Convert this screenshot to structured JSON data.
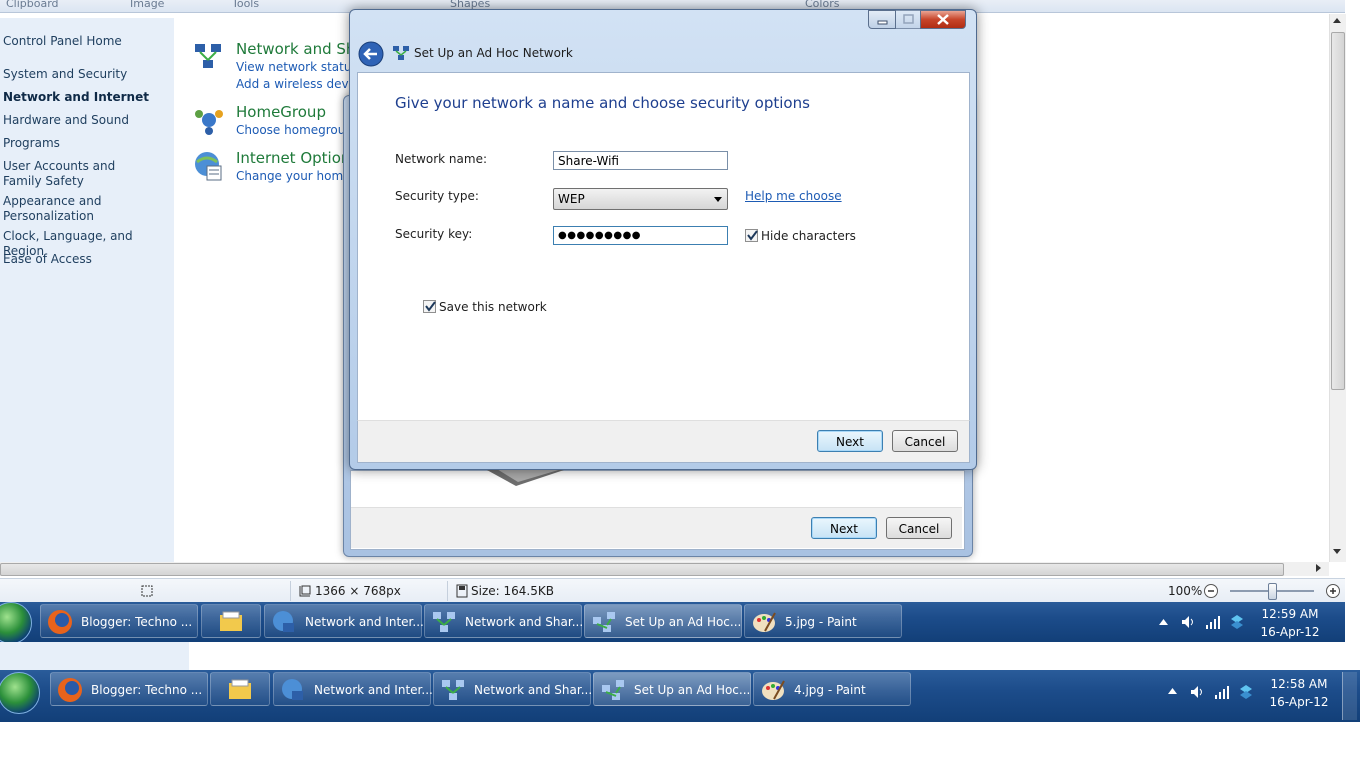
{
  "ribbon": {
    "labels": [
      "Clipboard",
      "Image",
      "Tools",
      "Shapes",
      "Colors"
    ]
  },
  "sidebar": {
    "home": "Control Panel Home",
    "items": [
      "System and Security",
      "Network and Internet",
      "Hardware and Sound",
      "Programs",
      "User Accounts and Family Safety",
      "Appearance and Personalization",
      "Clock, Language, and Region",
      "Ease of Access"
    ]
  },
  "main": {
    "categories": [
      {
        "title": "Network and Sh",
        "links": [
          "View network status a",
          "Add a wireless device"
        ],
        "icon": "network-sharing-icon"
      },
      {
        "title": "HomeGroup",
        "links": [
          "Choose homegroup"
        ],
        "icon": "homegroup-icon"
      },
      {
        "title": "Internet Option",
        "links": [
          "Change your homep"
        ],
        "icon": "internet-options-icon"
      }
    ]
  },
  "dialog": {
    "title": "Set Up an Ad Hoc Network",
    "heading": "Give your network a name and choose security options",
    "network_name_label": "Network name:",
    "network_name_value": "Share-Wifi",
    "security_type_label": "Security type:",
    "security_type_value": "WEP",
    "help_link": "Help me choose",
    "security_key_label": "Security key:",
    "security_key_value": "●●●●●●●●●",
    "hide_characters_label": "Hide characters",
    "hide_characters_checked": true,
    "save_network_label": "Save this network",
    "save_network_checked": true,
    "next_label": "Next",
    "cancel_label": "Cancel"
  },
  "back_dialog": {
    "next_label": "Next",
    "cancel_label": "Cancel"
  },
  "statusbar": {
    "dimensions": "1366 × 768px",
    "size": "Size: 164.5KB",
    "zoom": "100%"
  },
  "taskbar_top": {
    "items": [
      {
        "label": "Blogger: Techno ...",
        "icon": "firefox-icon"
      },
      {
        "label": "",
        "icon": "file-explorer-icon"
      },
      {
        "label": "Network and Inter...",
        "icon": "network-internet-icon"
      },
      {
        "label": "Network and Shar...",
        "icon": "network-sharing-icon"
      },
      {
        "label": "Set Up an Ad Hoc...",
        "icon": "adhoc-network-icon"
      },
      {
        "label": "5.jpg - Paint",
        "icon": "paint-icon"
      }
    ],
    "time": "12:59 AM",
    "date": "16-Apr-12"
  },
  "taskbar_bottom": {
    "items": [
      {
        "label": "Blogger: Techno ...",
        "icon": "firefox-icon"
      },
      {
        "label": "",
        "icon": "file-explorer-icon"
      },
      {
        "label": "Network and Inter...",
        "icon": "network-internet-icon"
      },
      {
        "label": "Network and Shar...",
        "icon": "network-sharing-icon"
      },
      {
        "label": "Set Up an Ad Hoc...",
        "icon": "adhoc-network-icon"
      },
      {
        "label": "4.jpg - Paint",
        "icon": "paint-icon"
      }
    ],
    "time": "12:58 AM",
    "date": "16-Apr-12"
  },
  "colors": {
    "link": "#1d5bb4",
    "category_title": "#1f7a3a",
    "dialog_heading": "#1e3f8f",
    "taskbar": "#1c4c8a"
  }
}
